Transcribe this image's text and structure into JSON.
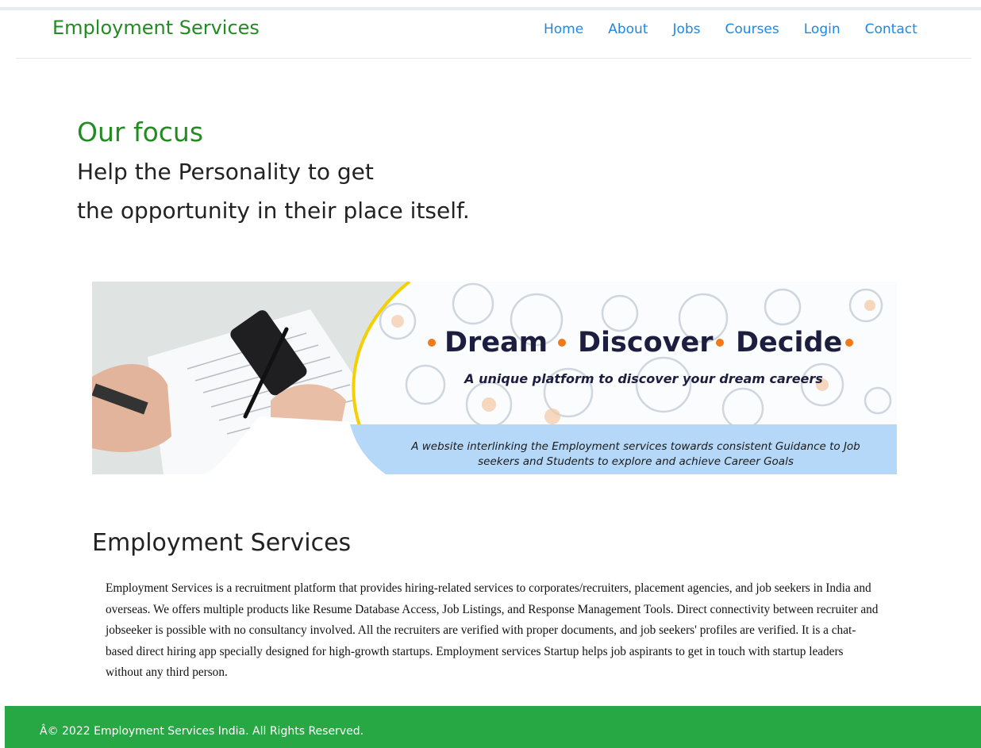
{
  "brand": "Employment Services",
  "nav": {
    "home": "Home",
    "about": "About",
    "jobs": "Jobs",
    "courses": "Courses",
    "login": "Login",
    "contact": "Contact"
  },
  "hero": {
    "title": "Our focus",
    "line1": "Help the Personality to get",
    "line2": "the opportunity in their place itself."
  },
  "banner": {
    "word1": "Dream",
    "word2": "Discover",
    "word3": "Decide",
    "tagline": "A unique platform to discover your dream careers",
    "desc1": "A website interlinking the Employment services towards consistent Guidance to Job",
    "desc2": "seekers and Students to explore and achieve Career Goals"
  },
  "section": {
    "title": "Employment Services",
    "body": "Employment Services is a recruitment platform that provides hiring-related services to corporates/recruiters, placement agencies, and job seekers in India and overseas. We offers multiple products like Resume Database Access, Job Listings, and Response Management Tools. Direct connectivity between recruiter and jobseeker is possible with no consultancy involved. All the recruiters are verified with proper documents, and job seekers' profiles are verified. It is a chat-based direct hiring app specially designed for high-growth startups. Employment services Startup helps job aspirants to get in touch with startup leaders without any third person."
  },
  "footer": {
    "copyright": "Â© 2022 Employment Services India. All Rights Reserved."
  },
  "colors": {
    "brand_green": "#228b22",
    "nav_link": "#1e88e5",
    "footer_bg": "#28a745",
    "banner_navy": "#1d1d3f",
    "banner_orange": "#f07a1a",
    "banner_yellow": "#f5d000",
    "banner_band": "#b5d8f8"
  }
}
